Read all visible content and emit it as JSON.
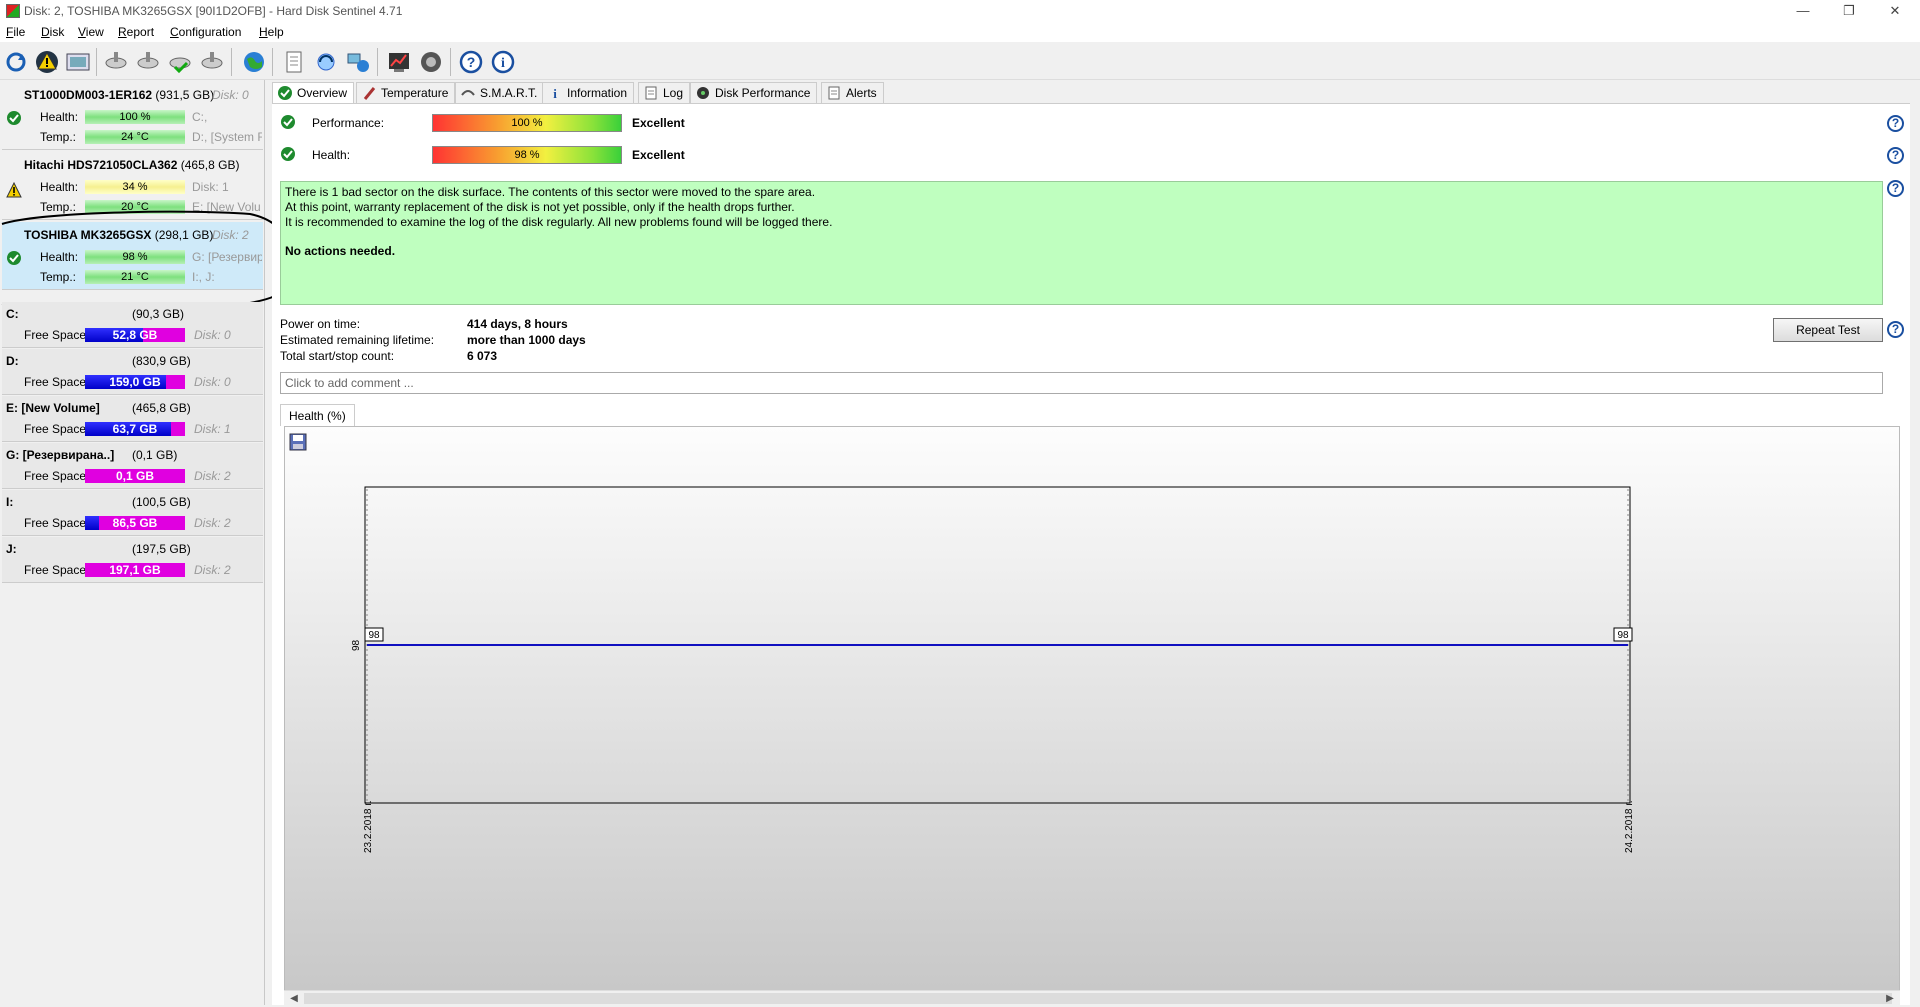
{
  "window": {
    "title": "Disk: 2, TOSHIBA MK3265GSX [90I1D2OFB]  -  Hard Disk Sentinel 4.71"
  },
  "menu": [
    "File",
    "Disk",
    "View",
    "Report",
    "Configuration",
    "Help"
  ],
  "disks": [
    {
      "name": "ST1000DM003-1ER162",
      "size": "(931,5 GB)",
      "disk": "Disk: 0",
      "status": "ok",
      "health": "100 %",
      "health_level": 100,
      "temp": "24 °C",
      "info1": "C:,",
      "info2": "D:, [System R"
    },
    {
      "name": "Hitachi HDS721050CLA362",
      "size": "(465,8 GB)",
      "disk": "Disk: 1",
      "status": "warning",
      "health": "34 %",
      "health_level": 34,
      "temp": "20 °C",
      "info1": "Disk: 1",
      "info2": "E: [New Volu"
    },
    {
      "name": "TOSHIBA MK3265GSX",
      "size": "(298,1 GB)",
      "disk": "Disk: 2",
      "status": "ok",
      "health": "98 %",
      "health_level": 98,
      "temp": "21 °C",
      "info1": "G: [Резервира",
      "info2": "I:, J:"
    }
  ],
  "disk_labels": {
    "health": "Health:",
    "temp": "Temp.:"
  },
  "volumes": [
    {
      "name": "C:",
      "size": "(90,3 GB)",
      "free_label": "Free Space",
      "free": "52,8 GB",
      "free_ratio": 0.58,
      "disk": "Disk: 0"
    },
    {
      "name": "D:",
      "size": "(830,9 GB)",
      "free_label": "Free Space",
      "free": "159,0 GB",
      "free_ratio": 0.81,
      "disk": "Disk: 0"
    },
    {
      "name": "E: [New Volume]",
      "size": "(465,8 GB)",
      "free_label": "Free Space",
      "free": "63,7 GB",
      "free_ratio": 0.86,
      "disk": "Disk: 1"
    },
    {
      "name": "G: [Резервирана..]",
      "size": "(0,1 GB)",
      "free_label": "Free Space",
      "free": "0,1 GB",
      "free_ratio": 0.0,
      "disk": "Disk: 2"
    },
    {
      "name": "I:",
      "size": "(100,5 GB)",
      "free_label": "Free Space",
      "free": "86,5 GB",
      "free_ratio": 0.14,
      "disk": "Disk: 2"
    },
    {
      "name": "J:",
      "size": "(197,5 GB)",
      "free_label": "Free Space",
      "free": "197,1 GB",
      "free_ratio": 0.0,
      "disk": "Disk: 2"
    }
  ],
  "tabs": [
    "Overview",
    "Temperature",
    "S.M.A.R.T.",
    "Information",
    "Log",
    "Disk Performance",
    "Alerts"
  ],
  "overview": {
    "performance_label": "Performance:",
    "performance_value": "100 %",
    "performance_level": 100,
    "performance_rating": "Excellent",
    "health_label": "Health:",
    "health_value": "98 %",
    "health_level": 98,
    "health_rating": "Excellent",
    "message_lines": [
      "There is 1 bad sector on the disk surface. The contents of this sector were moved to the spare area.",
      "At this point, warranty replacement of the disk is not yet possible, only if the health drops further.",
      "It is recommended to examine the log of the disk regularly. All new problems found will be logged there."
    ],
    "message_bold": "No actions needed.",
    "power_on_label": "Power on time:",
    "power_on_value": "414 days, 8 hours",
    "lifetime_label": "Estimated remaining lifetime:",
    "lifetime_value": "more than 1000 days",
    "startstop_label": "Total start/stop count:",
    "startstop_value": "6 073",
    "repeat_button": "Repeat Test",
    "comment_placeholder": "Click to add comment ...",
    "help_symbol": "?"
  },
  "graph_tab": "Health (%)",
  "chart_data": {
    "type": "line",
    "title": "",
    "x": [
      "23.2.2018 г.",
      "24.2.2018 г."
    ],
    "series": [
      {
        "values": [
          98,
          98
        ]
      }
    ],
    "point_labels": [
      "98",
      "98"
    ],
    "ylabel_tick": "98",
    "color": "#1010c0"
  }
}
